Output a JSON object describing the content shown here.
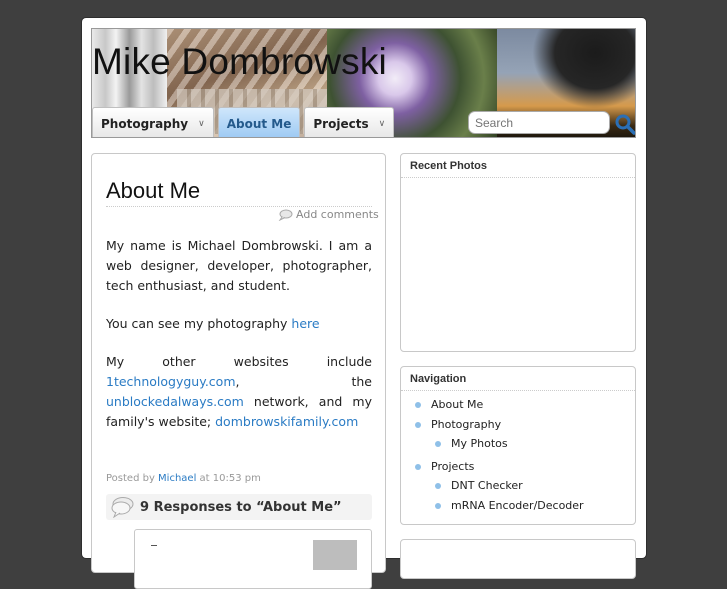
{
  "header": {
    "site_title": "Mike Dombrowski",
    "nav": [
      {
        "label": "Photography",
        "active": false,
        "has_dropdown": true
      },
      {
        "label": "About Me",
        "active": true,
        "has_dropdown": false
      },
      {
        "label": "Projects",
        "active": false,
        "has_dropdown": true
      }
    ],
    "search": {
      "placeholder": "Search",
      "icon": "magnifier-icon"
    }
  },
  "post": {
    "title": "About Me",
    "comments_link": "Add comments",
    "paragraph1": "My name is Michael Dombrowski. I am a web designer, developer, photographer, tech enthusiast, and student.",
    "paragraph2_text": "You can see my photography ",
    "paragraph2_link": "here",
    "paragraph3_text": "My other websites include ",
    "links": {
      "site1": "1technologyguy.com",
      "between1": ", the ",
      "site2": "unblockedalways.com",
      "between2": " network, and my family's website; ",
      "site3": "dombrowskifamily.com"
    },
    "meta_prefix": "Posted by ",
    "meta_author": "Michael",
    "meta_time": " at 10:53 pm",
    "responses": "9 Responses to “About Me”"
  },
  "sidebar": {
    "recent_photos_title": "Recent Photos",
    "navigation_title": "Navigation",
    "items": {
      "about": "About Me",
      "photography": "Photography",
      "my_photos": "My Photos",
      "projects": "Projects",
      "dnt": "DNT Checker",
      "mrna": "mRNA Encoder/Decoder"
    }
  },
  "colors": {
    "background": "#3f3f3f",
    "link": "#2a7bc4",
    "active_tab": "#9cc9f3",
    "bullet": "#8fc0e8"
  }
}
